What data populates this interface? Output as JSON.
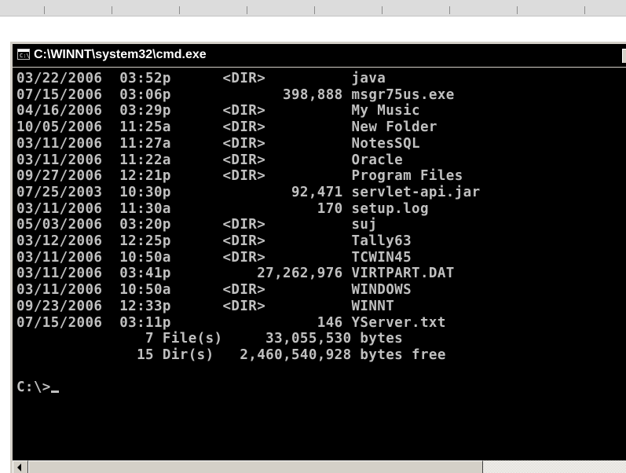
{
  "window": {
    "title": "C:\\WINNT\\system32\\cmd.exe",
    "icon_text": "C:\\"
  },
  "console": {
    "lines": [
      "03/22/2006  03:52p      <DIR>          java",
      "07/15/2006  03:06p             398,888 msgr75us.exe",
      "04/16/2006  03:29p      <DIR>          My Music",
      "10/05/2006  11:25a      <DIR>          New Folder",
      "03/11/2006  11:27a      <DIR>          NotesSQL",
      "03/11/2006  11:22a      <DIR>          Oracle",
      "09/27/2006  12:21p      <DIR>          Program Files",
      "07/25/2003  10:30p              92,471 servlet-api.jar",
      "03/11/2006  11:30a                 170 setup.log",
      "05/03/2006  03:20p      <DIR>          suj",
      "03/12/2006  12:25p      <DIR>          Tally63",
      "03/11/2006  10:50a      <DIR>          TCWIN45",
      "03/11/2006  03:41p          27,262,976 VIRTPART.DAT",
      "03/11/2006  10:50a      <DIR>          WINDOWS",
      "09/23/2006  12:33p      <DIR>          WINNT",
      "07/15/2006  03:11p                 146 YServer.txt",
      "               7 File(s)     33,055,530 bytes",
      "              15 Dir(s)   2,460,540,928 bytes free",
      "",
      "C:\\>"
    ]
  },
  "colors": {
    "console_bg": "#000000",
    "console_fg": "#c0c0c0",
    "titlebar_bg": "#000000",
    "title_fg": "#ffffff",
    "chrome": "#d4d0c8"
  },
  "icons": {
    "window_icon": "cmd-window-icon",
    "scroll_left": "scroll-left-arrow-icon"
  }
}
